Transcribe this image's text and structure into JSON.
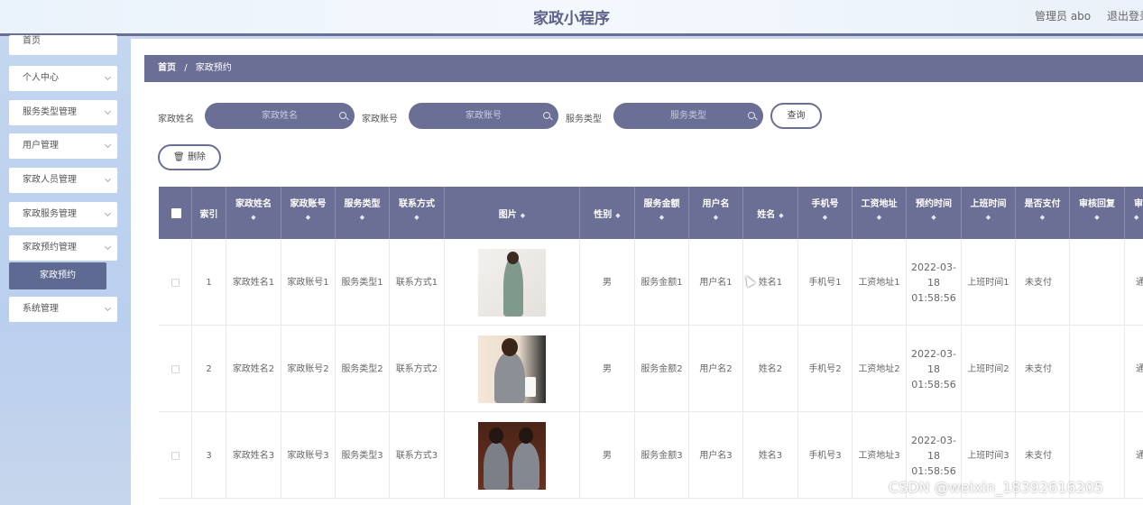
{
  "header": {
    "title": "家政小程序",
    "admin": "管理员 abo",
    "logout": "退出登录"
  },
  "sidebar": {
    "items": [
      {
        "label": "首页"
      },
      {
        "label": "个人中心"
      },
      {
        "label": "服务类型管理"
      },
      {
        "label": "用户管理"
      },
      {
        "label": "家政人员管理"
      },
      {
        "label": "家政服务管理"
      },
      {
        "label": "家政预约管理"
      },
      {
        "label": "系统管理"
      }
    ],
    "active_sub": "家政预约"
  },
  "breadcrumb": {
    "home": "首页",
    "sep": "/",
    "current": "家政预约"
  },
  "search": {
    "name_label": "家政姓名",
    "name_placeholder": "家政姓名",
    "account_label": "家政账号",
    "account_placeholder": "家政账号",
    "type_label": "服务类型",
    "type_placeholder": "服务类型",
    "query_button": "查询"
  },
  "toolbar": {
    "delete_label": "删除"
  },
  "table": {
    "sort_glyph": "◆",
    "headers": {
      "index": "索引",
      "name": "家政姓名",
      "account": "家政账号",
      "type": "服务类型",
      "contact": "联系方式",
      "picture": "图片",
      "gender": "性别",
      "amount": "服务金额",
      "username": "用户名",
      "realname": "姓名",
      "phone": "手机号",
      "address": "工资地址",
      "time": "预约时间",
      "work": "上班时间",
      "paid": "是否支付",
      "reply": "审核回复",
      "audit": "审核"
    },
    "rows": [
      {
        "index": "1",
        "name": "家政姓名1",
        "account": "家政账号1",
        "type": "服务类型1",
        "contact": "联系方式1",
        "gender": "男",
        "amount": "服务金额1",
        "username": "用户名1",
        "realname": "姓名1",
        "phone": "手机号1",
        "address": "工资地址1",
        "time": "2022-03-18 01:58:56",
        "work": "上班时间1",
        "paid": "未支付",
        "reply": "",
        "audit": "通"
      },
      {
        "index": "2",
        "name": "家政姓名2",
        "account": "家政账号2",
        "type": "服务类型2",
        "contact": "联系方式2",
        "gender": "男",
        "amount": "服务金额2",
        "username": "用户名2",
        "realname": "姓名2",
        "phone": "手机号2",
        "address": "工资地址2",
        "time": "2022-03-18 01:58:56",
        "work": "上班时间2",
        "paid": "未支付",
        "reply": "",
        "audit": "通"
      },
      {
        "index": "3",
        "name": "家政姓名3",
        "account": "家政账号3",
        "type": "服务类型3",
        "contact": "联系方式3",
        "gender": "男",
        "amount": "服务金额3",
        "username": "用户名3",
        "realname": "姓名3",
        "phone": "手机号3",
        "address": "工资地址3",
        "time": "2022-03-18 01:58:56",
        "work": "上班时间3",
        "paid": "未支付",
        "reply": "",
        "audit": "通"
      }
    ]
  },
  "watermark": "CSDN @weixin_18392616205",
  "colors": {
    "accent": "#6c6f95",
    "sidebar": "#c3d6ef"
  }
}
